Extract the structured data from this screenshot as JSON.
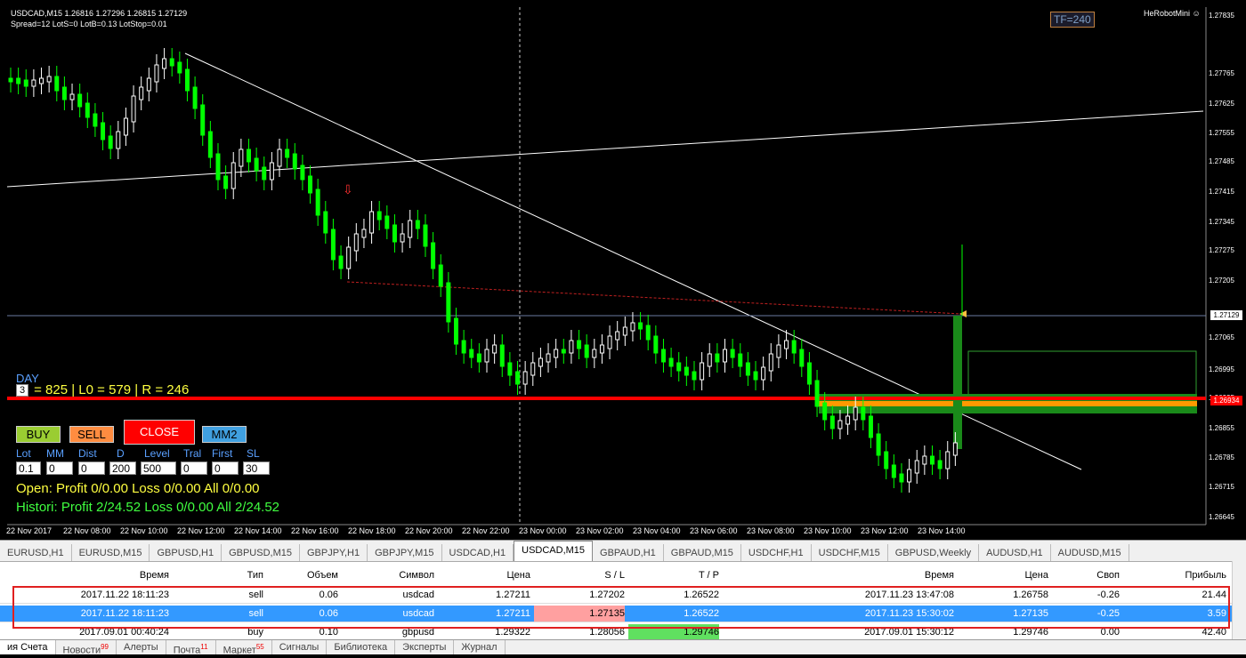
{
  "header": {
    "line1": "USDCAD,M15  1.26816 1.27296 1.26815 1.27129",
    "line2": "Spread=12  LotS=0  LotB=0.13  LotStop=0.01",
    "tf_badge": "TF=240",
    "robot": "HeRobotMini ☺"
  },
  "panel": {
    "day_label": "DAY",
    "day_value": "3",
    "levels_text": "= 825 | L0 = 579 | R = 246",
    "buy": "BUY",
    "sell": "SELL",
    "close": "CLOSE",
    "mm2": "MM2",
    "field_labels": [
      "Lot",
      "MM",
      "Dist",
      "D",
      "Level",
      "Tral",
      "First",
      "SL"
    ],
    "field_values": [
      "0.1",
      "0",
      "0",
      "200",
      "500",
      "0",
      "0",
      "30"
    ],
    "open_line": "Open:  Profit 0/0.00  Loss 0/0.00  All 0/0.00",
    "hist_line": "Histori: Profit 2/24.52  Loss 0/0.00  All 2/24.52"
  },
  "yaxis": [
    "1.27835",
    "1.27765",
    "1.27625",
    "1.27555",
    "1.27485",
    "1.27415",
    "1.27345",
    "1.27275",
    "1.27205",
    "1.27065",
    "1.26995",
    "1.26925",
    "1.26855",
    "1.26785",
    "1.26715",
    "1.26645"
  ],
  "current_price": "1.27129",
  "red_level_price": "1.26934",
  "xaxis": [
    "22 Nov 2017",
    "22 Nov 08:00",
    "22 Nov 10:00",
    "22 Nov 12:00",
    "22 Nov 14:00",
    "22 Nov 16:00",
    "22 Nov 18:00",
    "22 Nov 20:00",
    "22 Nov 22:00",
    "23 Nov 00:00",
    "23 Nov 02:00",
    "23 Nov 04:00",
    "23 Nov 06:00",
    "23 Nov 08:00",
    "23 Nov 10:00",
    "23 Nov 12:00",
    "23 Nov 14:00"
  ],
  "symbol_tabs": [
    "EURUSD,H1",
    "EURUSD,M15",
    "GBPUSD,H1",
    "GBPUSD,M15",
    "GBPJPY,H1",
    "GBPJPY,M15",
    "USDCAD,H1",
    "USDCAD,M15",
    "GBPAUD,H1",
    "GBPAUD,M15",
    "USDCHF,H1",
    "USDCHF,M15",
    "GBPUSD,Weekly",
    "AUDUSD,H1",
    "AUDUSD,M15"
  ],
  "active_symbol_tab": "USDCAD,M15",
  "table": {
    "headers": [
      "Время",
      "Тип",
      "Объем",
      "Символ",
      "Цена",
      "S / L",
      "T / P",
      "Время",
      "Цена",
      "Своп",
      "Прибыль"
    ],
    "rows": [
      [
        "2017.11.22 18:11:23",
        "sell",
        "0.06",
        "usdcad",
        "1.27211",
        "1.27202",
        "1.26522",
        "2017.11.23 13:47:08",
        "1.26758",
        "-0.26",
        "21.44"
      ],
      [
        "2017.11.22 18:11:23",
        "sell",
        "0.06",
        "usdcad",
        "1.27211",
        "1.27135",
        "1.26522",
        "2017.11.23 15:30:02",
        "1.27135",
        "-0.25",
        "3.59"
      ],
      [
        "2017.09.01 00:40:24",
        "buy",
        "0.10",
        "gbpusd",
        "1.29322",
        "1.28056",
        "1.29746",
        "2017.09.01 15:30:12",
        "1.29746",
        "0.00",
        "42.40"
      ]
    ]
  },
  "bottom_tabs": [
    {
      "label": "ия Счета",
      "badge": ""
    },
    {
      "label": "Новости",
      "badge": "99"
    },
    {
      "label": "Алерты",
      "badge": ""
    },
    {
      "label": "Почта",
      "badge": "11"
    },
    {
      "label": "Маркет",
      "badge": "55"
    },
    {
      "label": "Сигналы",
      "badge": ""
    },
    {
      "label": "Библиотека",
      "badge": ""
    },
    {
      "label": "Эксперты",
      "badge": ""
    },
    {
      "label": "Журнал",
      "badge": ""
    }
  ],
  "colors": {
    "bull": "#ffffff",
    "bear": "#00ff00",
    "red_line": "#ff0000",
    "buy_btn": "#9acd32",
    "sell_btn": "#ff8c40",
    "close_btn": "#ff0000",
    "mm2_btn": "#40a0e0",
    "row_selected": "#3399ff"
  }
}
